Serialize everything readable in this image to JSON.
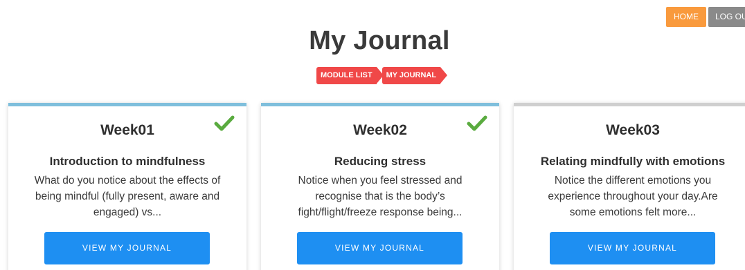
{
  "nav": {
    "home_label": "HOME",
    "logout_label": "LOG OUT"
  },
  "page": {
    "title": "My Journal"
  },
  "breadcrumb": [
    "MODULE LIST",
    "MY JOURNAL"
  ],
  "colors": {
    "home": "#f99a3d",
    "logout": "#8a8a8a",
    "breadcrumb": "#f04848",
    "completed_bar": "#7fbfdc",
    "pending_bar": "#cfcfcf",
    "button": "#1e8ff2",
    "check": "#5aab3f"
  },
  "cards": [
    {
      "week": "Week01",
      "completed": true,
      "topic": "Introduction to mindfulness",
      "desc": [
        "What do you notice about the effects of",
        "being mindful (fully present, aware and",
        "engaged) vs..."
      ],
      "button": "VIEW MY JOURNAL",
      "icon": "check-icon"
    },
    {
      "week": "Week02",
      "completed": true,
      "topic": "Reducing stress",
      "desc": [
        "Notice when you feel stressed and",
        "recognise that is the body’s",
        "fight/flight/freeze response being..."
      ],
      "button": "VIEW MY JOURNAL",
      "icon": "check-icon"
    },
    {
      "week": "Week03",
      "completed": false,
      "topic": "Relating mindfully with emotions",
      "desc": [
        "Notice the different emotions you",
        "experience throughout your day.Are",
        "some emotions felt more..."
      ],
      "button": "VIEW MY JOURNAL"
    }
  ]
}
